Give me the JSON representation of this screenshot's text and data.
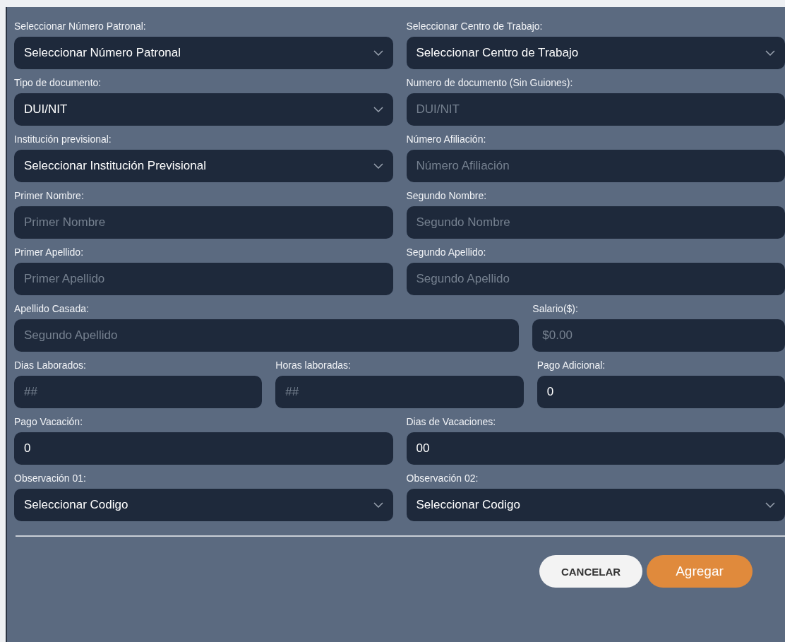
{
  "form": {
    "rows": [
      {
        "kind": "pair",
        "fields": [
          {
            "kind": "select",
            "label": "Seleccionar Número Patronal:",
            "value": "Seleccionar Número Patronal"
          },
          {
            "kind": "select",
            "label": "Seleccionar Centro de Trabajo:",
            "value": "Seleccionar Centro de Trabajo"
          }
        ]
      },
      {
        "kind": "pair",
        "fields": [
          {
            "kind": "select",
            "label": "Tipo de documento:",
            "value": "DUI/NIT"
          },
          {
            "kind": "input",
            "label": "Numero de documento (Sin Guiones):",
            "placeholder": "DUI/NIT"
          }
        ]
      },
      {
        "kind": "pair",
        "fields": [
          {
            "kind": "select",
            "label": "Institución previsional:",
            "value": "Seleccionar Institución Previsional"
          },
          {
            "kind": "input",
            "label": "Número Afiliación:",
            "placeholder": "Número Afiliación"
          }
        ]
      },
      {
        "kind": "pair",
        "fields": [
          {
            "kind": "input",
            "label": "Primer Nombre:",
            "placeholder": "Primer Nombre"
          },
          {
            "kind": "input",
            "label": "Segundo Nombre:",
            "placeholder": "Segundo Nombre"
          }
        ]
      },
      {
        "kind": "pair",
        "fields": [
          {
            "kind": "input",
            "label": "Primer Apellido:",
            "placeholder": "Primer Apellido"
          },
          {
            "kind": "input",
            "label": "Segundo Apellido:",
            "placeholder": "Segundo Apellido"
          }
        ]
      },
      {
        "kind": "wide",
        "fields": [
          {
            "kind": "input",
            "label": "Apellido Casada:",
            "placeholder": "Segundo Apellido"
          },
          {
            "kind": "input",
            "label": "Salario($):",
            "placeholder": "$0.00"
          }
        ]
      },
      {
        "kind": "triple",
        "fields": [
          {
            "kind": "input",
            "label": "Dias Laborados:",
            "placeholder": "##"
          },
          {
            "kind": "input",
            "label": "Horas laboradas:",
            "placeholder": "##"
          },
          {
            "kind": "input",
            "label": "Pago Adicional:",
            "value": "0"
          }
        ]
      },
      {
        "kind": "pair",
        "fields": [
          {
            "kind": "input",
            "label": "Pago Vacación:",
            "value": "0"
          },
          {
            "kind": "input",
            "label": "Dias de Vacaciones:",
            "value": "00"
          }
        ]
      },
      {
        "kind": "pair",
        "fields": [
          {
            "kind": "select",
            "label": "Observación 01:",
            "value": "Seleccionar Codigo"
          },
          {
            "kind": "select",
            "label": "Observación 02:",
            "value": "Seleccionar Codigo"
          }
        ]
      }
    ]
  },
  "buttons": [
    {
      "kind": "cancel",
      "label": "CANCELAR"
    },
    {
      "kind": "primary",
      "label": "Agregar"
    }
  ]
}
